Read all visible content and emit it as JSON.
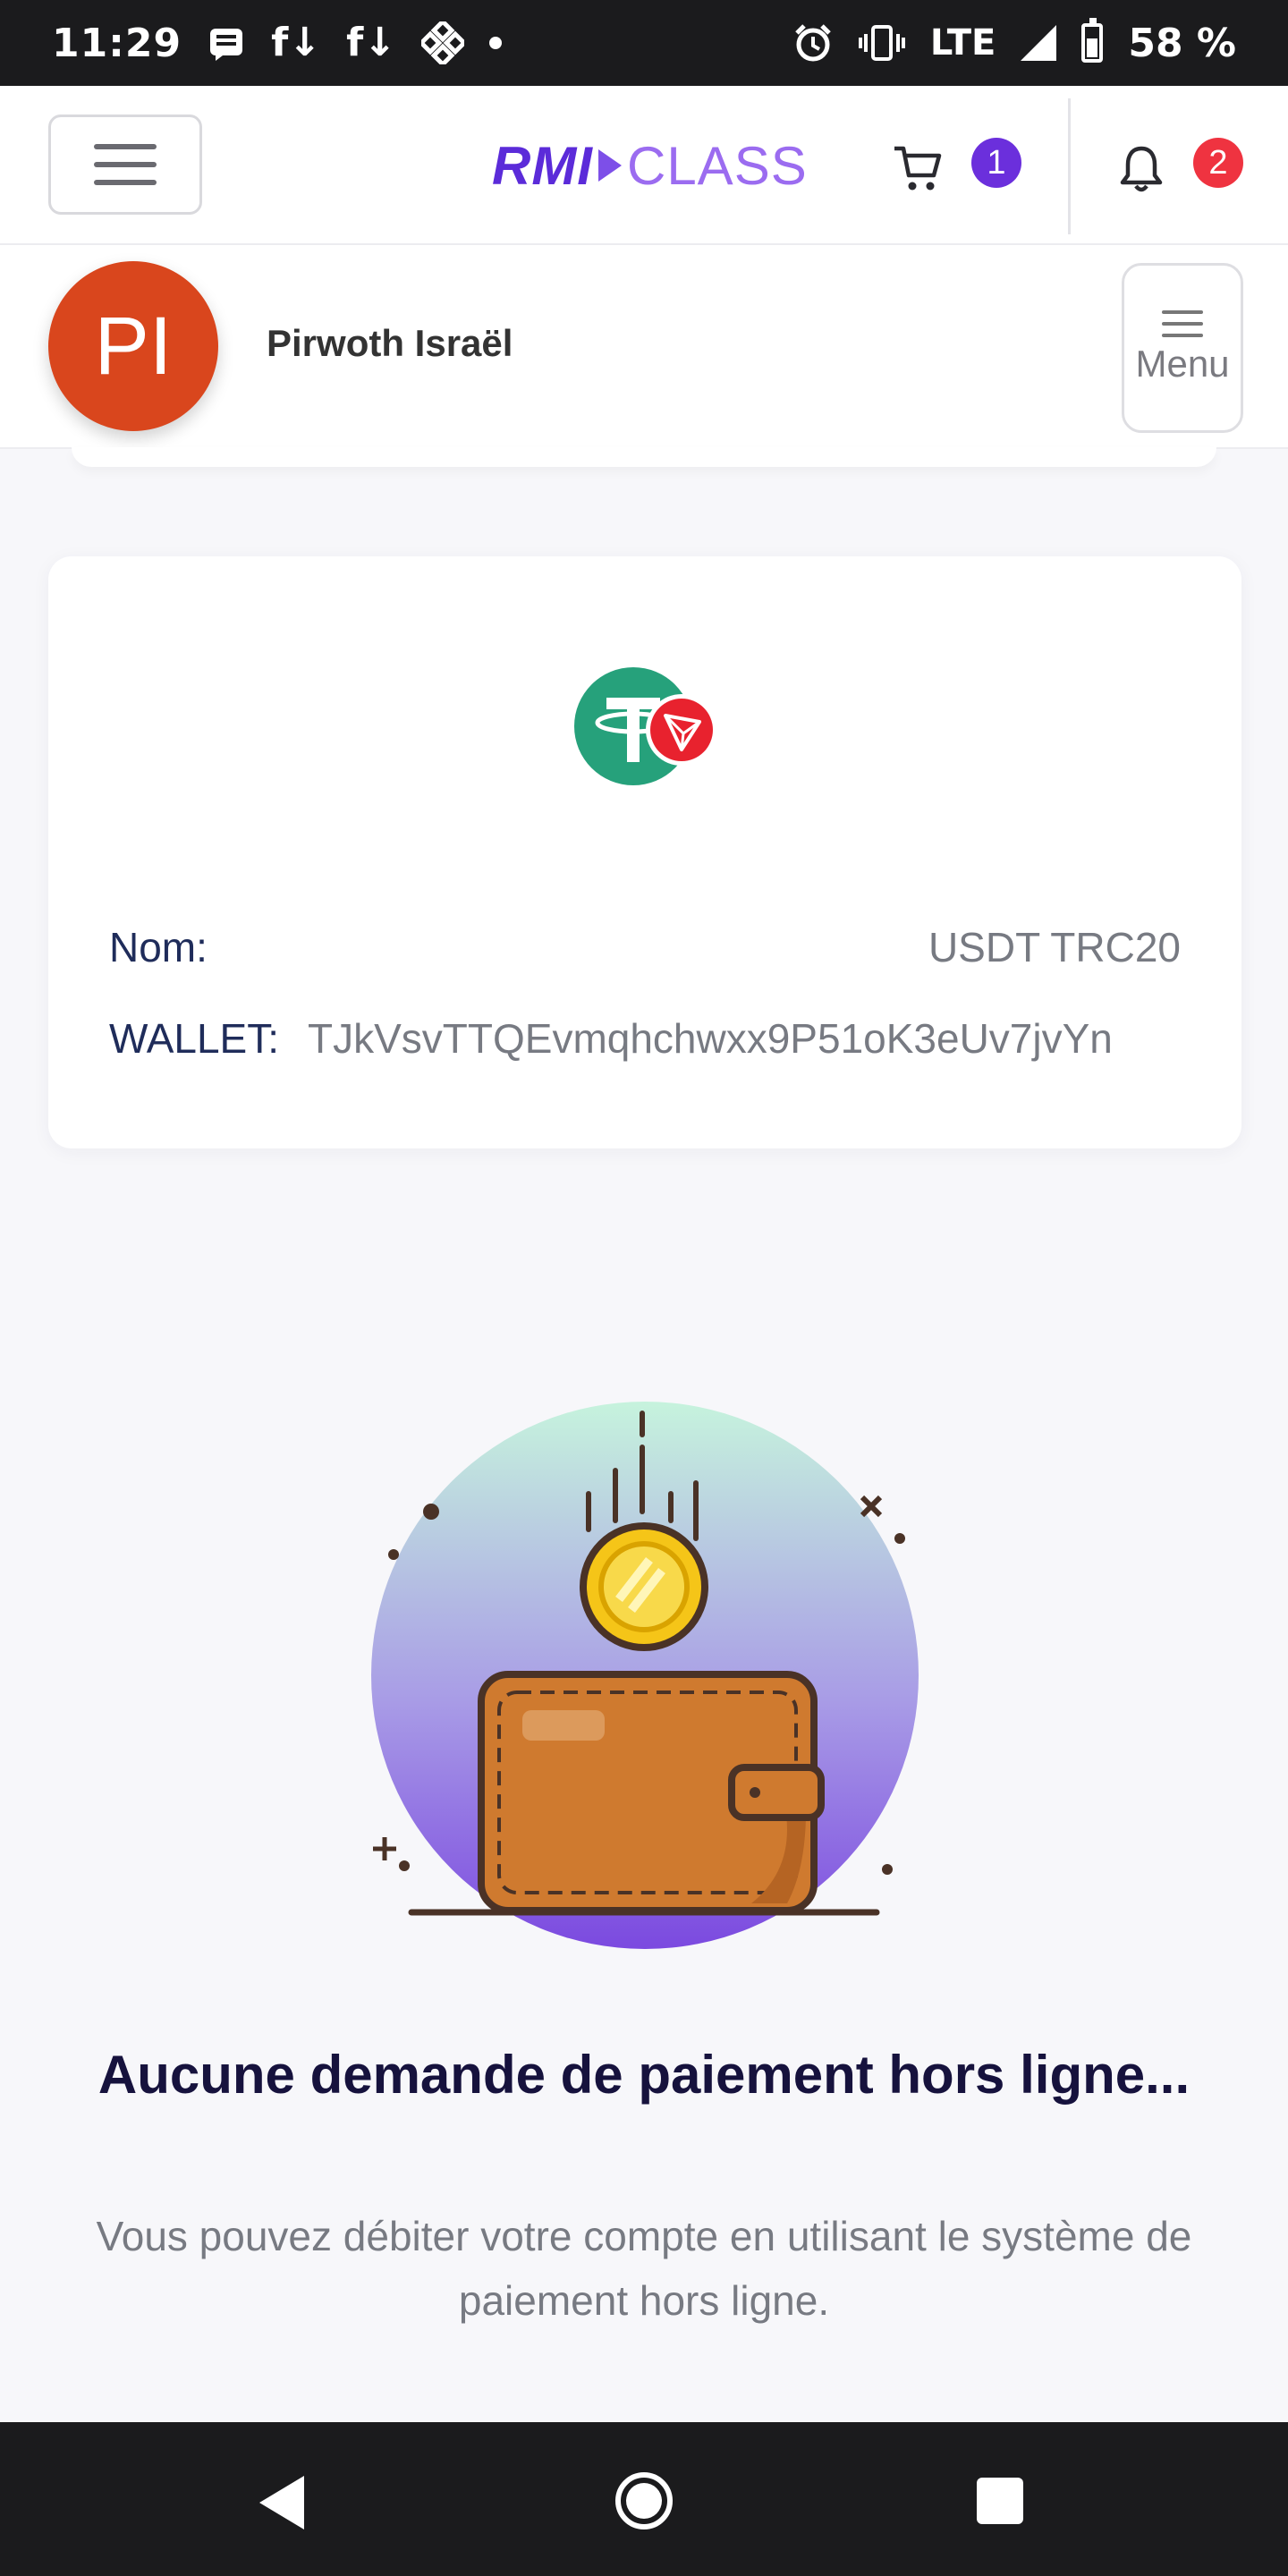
{
  "status_bar": {
    "time": "11:29",
    "network": "LTE",
    "battery": "58 %",
    "notification_icons": [
      "message-icon",
      "facebook-download-icon",
      "facebook-download-icon",
      "binance-icon"
    ],
    "system_icons": [
      "alarm-icon",
      "vibrate-icon",
      "signal-icon",
      "battery-icon"
    ]
  },
  "header": {
    "brand_part1": "RMI",
    "brand_part2": "CLASS",
    "cart_count": "1",
    "notification_count": "2",
    "accent_color": "#6b2fdc",
    "alert_color": "#ef3340"
  },
  "profile": {
    "initials": "PI",
    "name": "Pirwoth Israël",
    "menu_label": "Menu",
    "avatar_color": "#d9461d"
  },
  "wallet_card": {
    "token_icon": "usdt-tron-icon",
    "nom_label": "Nom:",
    "nom_value": "USDT TRC20",
    "wallet_label": "WALLET:",
    "wallet_value": "TJkVsvTTQEvmqhchwxx9P51oK3eUv7jvYn"
  },
  "empty_state": {
    "illustration": "wallet-coin-illustration",
    "title": "Aucune demande de paiement hors ligne...",
    "text": "Vous pouvez débiter votre compte en utilisant le système de paiement hors ligne."
  },
  "nav_bar": {
    "buttons": [
      "back-icon",
      "home-icon",
      "recents-icon"
    ]
  }
}
